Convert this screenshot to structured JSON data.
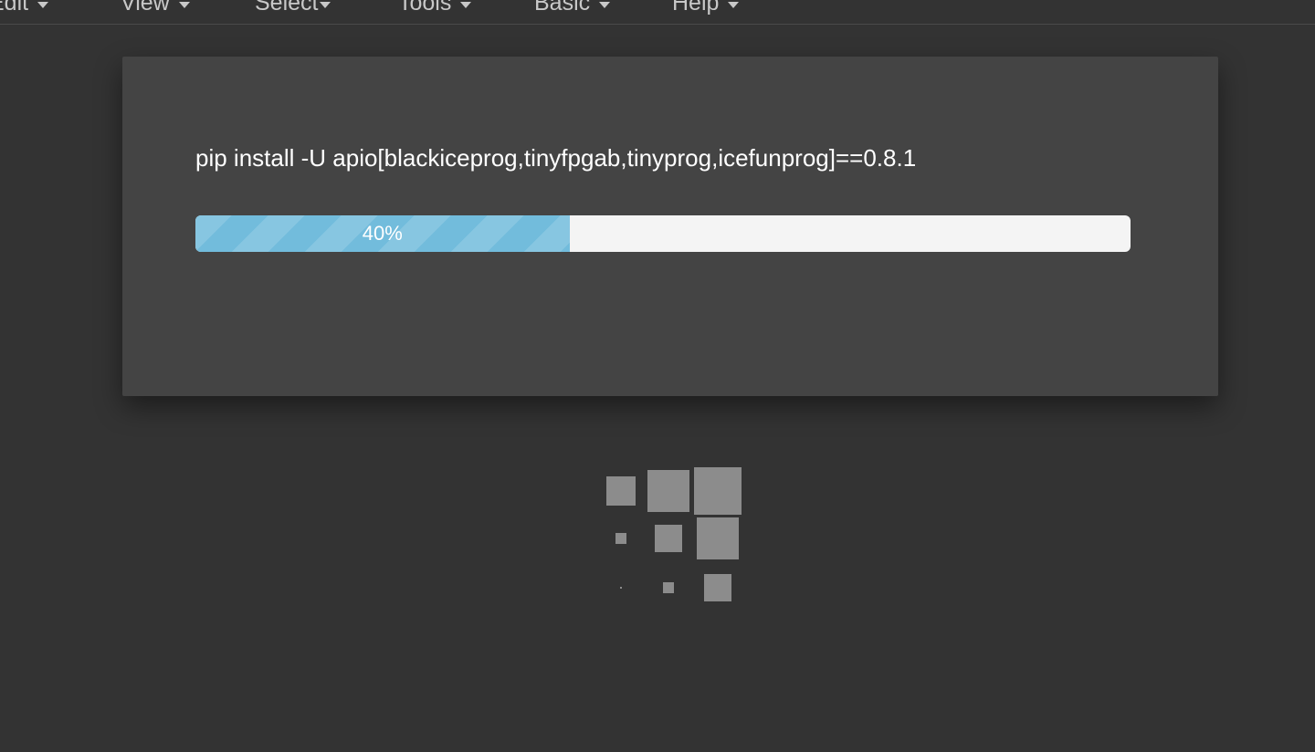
{
  "menubar": {
    "items": [
      {
        "label": "Edit"
      },
      {
        "label": "View"
      },
      {
        "label": "Select"
      },
      {
        "label": "Tools"
      },
      {
        "label": "Basic"
      },
      {
        "label": "Help"
      }
    ]
  },
  "dialog": {
    "command": "pip install -U apio[blackiceprog,tinyfpgab,tinyprog,icefunprog]==0.8.1",
    "progress": {
      "percent": 40,
      "label": "40%"
    }
  },
  "icons": {
    "menu_caret": "chevron-down-icon",
    "loading": "loading-squares-icon"
  },
  "colors": {
    "background": "#333333",
    "dialog": "#444444",
    "progress_fill": "#72bcdc",
    "progress_track": "#f4f4f4",
    "spinner_squares": "#8c8c8c"
  }
}
